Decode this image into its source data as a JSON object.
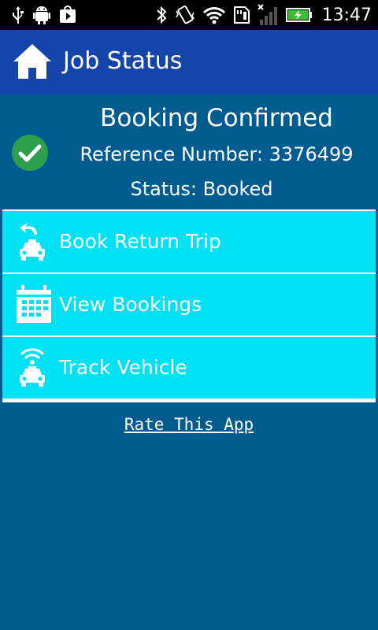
{
  "status_bar": {
    "time": "13:47",
    "icons": [
      "usb-icon",
      "android-debug-icon",
      "play-store-icon",
      "bluetooth-icon",
      "vibrate-icon",
      "wifi-icon",
      "sd-card-icon",
      "signal-icon",
      "battery-charging-icon"
    ]
  },
  "header": {
    "title": "Job Status",
    "icon": "home-icon"
  },
  "confirmation": {
    "title": "Booking Confirmed",
    "reference": "Reference Number: 3376499",
    "status": "Status: Booked",
    "icon": "check-circle-icon"
  },
  "menu": {
    "items": [
      {
        "label": "Book Return Trip",
        "icon": "return-taxi-icon"
      },
      {
        "label": "View Bookings",
        "icon": "calendar-icon"
      },
      {
        "label": "Track Vehicle",
        "icon": "tracking-taxi-icon"
      }
    ]
  },
  "footer": {
    "rate_link": "Rate This App"
  },
  "colors": {
    "background": "#005c8f",
    "app_bar": "#1545a8",
    "menu_item": "#00e2f4",
    "check": "#2e9e4c"
  }
}
